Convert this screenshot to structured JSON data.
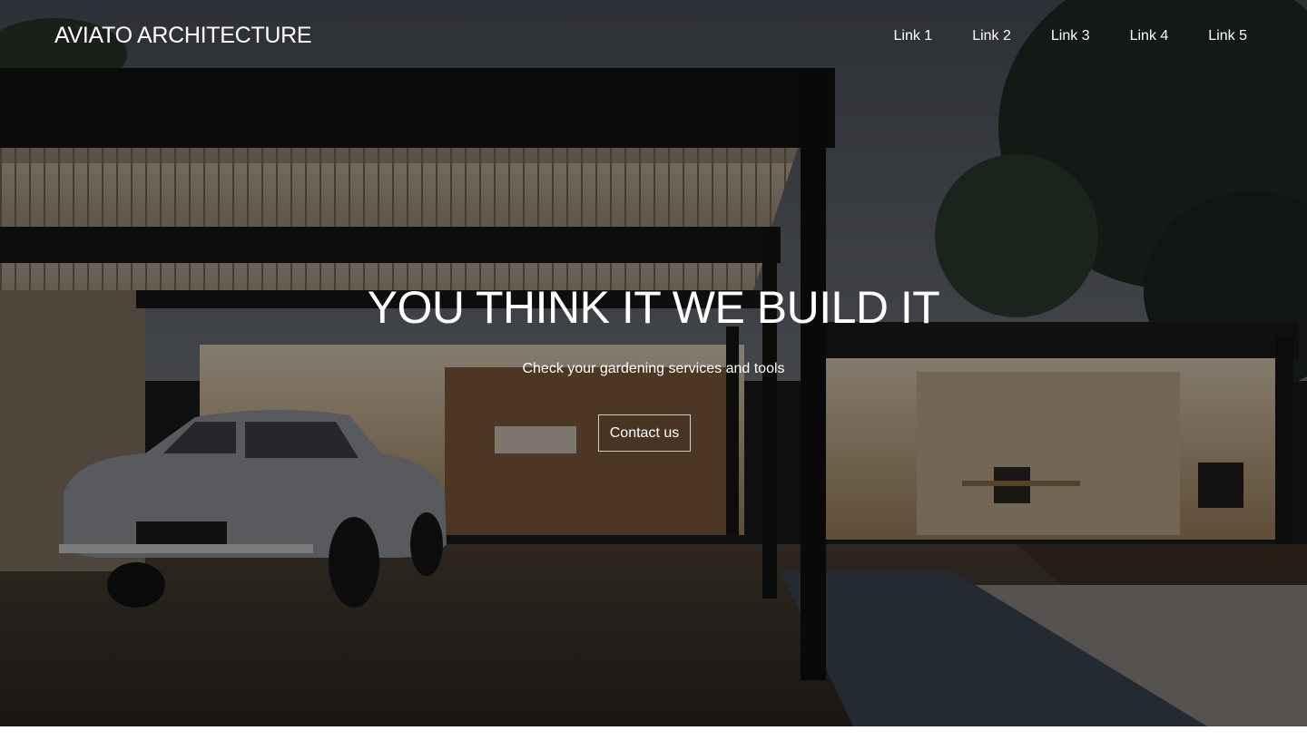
{
  "brand": {
    "name": "AVIATO ARCHITECTURE"
  },
  "nav": {
    "links": [
      "Link 1",
      "Link 2",
      "Link 3",
      "Link 4",
      "Link 5"
    ]
  },
  "hero": {
    "headline": "YOU THINK IT WE BUILD IT",
    "subheadline": "Check your gardening services and tools",
    "cta_label": "Contact us",
    "image": "modern-house-carport-with-vintage-car-at-dusk"
  },
  "colors": {
    "text": "#ffffff",
    "overlay": "#000000"
  }
}
